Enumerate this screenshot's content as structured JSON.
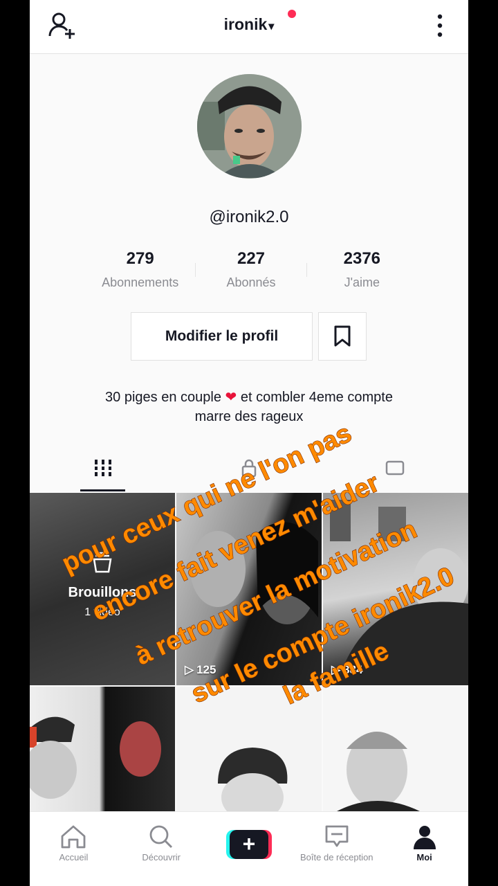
{
  "header": {
    "username": "ironik",
    "caret": "▾",
    "notification_color": "#fe2c55"
  },
  "profile": {
    "handle": "@ironik2.0",
    "stats": [
      {
        "value": "279",
        "label": "Abonnements"
      },
      {
        "value": "227",
        "label": "Abonnés"
      },
      {
        "value": "2376",
        "label": "J'aime"
      }
    ],
    "edit_label": "Modifier le profil",
    "bio_line1_a": "30 piges en couple",
    "bio_heart": "❤",
    "bio_line1_b": "et combler 4eme compte",
    "bio_line2": "marre des rageux"
  },
  "videos": {
    "drafts_title": "Brouillons",
    "drafts_count": "1 vidéo",
    "cell2_views": "125",
    "cell3_views": "384"
  },
  "overlay_text": {
    "line1": "pour ceux qui ne l'on pas",
    "line2": "encore fait venez m'aider",
    "line3": "à retrouver la motivation",
    "line4": "sur le compte ironik2.0",
    "line5": "la famille"
  },
  "nav": {
    "home": "Accueil",
    "discover": "Découvrir",
    "create": "+",
    "inbox": "Boîte de réception",
    "me": "Moi"
  }
}
